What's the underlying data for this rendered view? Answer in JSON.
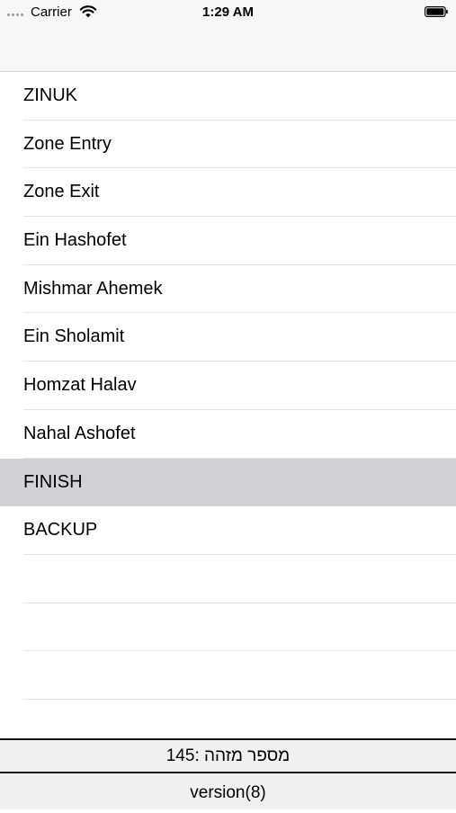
{
  "status_bar": {
    "carrier": "Carrier",
    "time": "1:29 AM",
    "icons": [
      "signal-dots-icon",
      "wifi-icon",
      "battery-icon"
    ]
  },
  "list": {
    "items": [
      {
        "label": "ZINUK"
      },
      {
        "label": "Zone Entry"
      },
      {
        "label": "Zone Exit"
      },
      {
        "label": "Ein Hashofet"
      },
      {
        "label": "Mishmar Ahemek"
      },
      {
        "label": "Ein Sholamit"
      },
      {
        "label": "Homzat Halav"
      },
      {
        "label": "Nahal Ashofet"
      },
      {
        "label": "FINISH",
        "selected": true
      },
      {
        "label": "BACKUP"
      }
    ],
    "empty_rows": 4
  },
  "footer": {
    "id_text": "מספר מזהה :145",
    "version": "version(8)"
  },
  "colors": {
    "selected_row": "#d1d1d6",
    "bar_background": "#f7f7f7",
    "separator": "#e4e4e6"
  }
}
